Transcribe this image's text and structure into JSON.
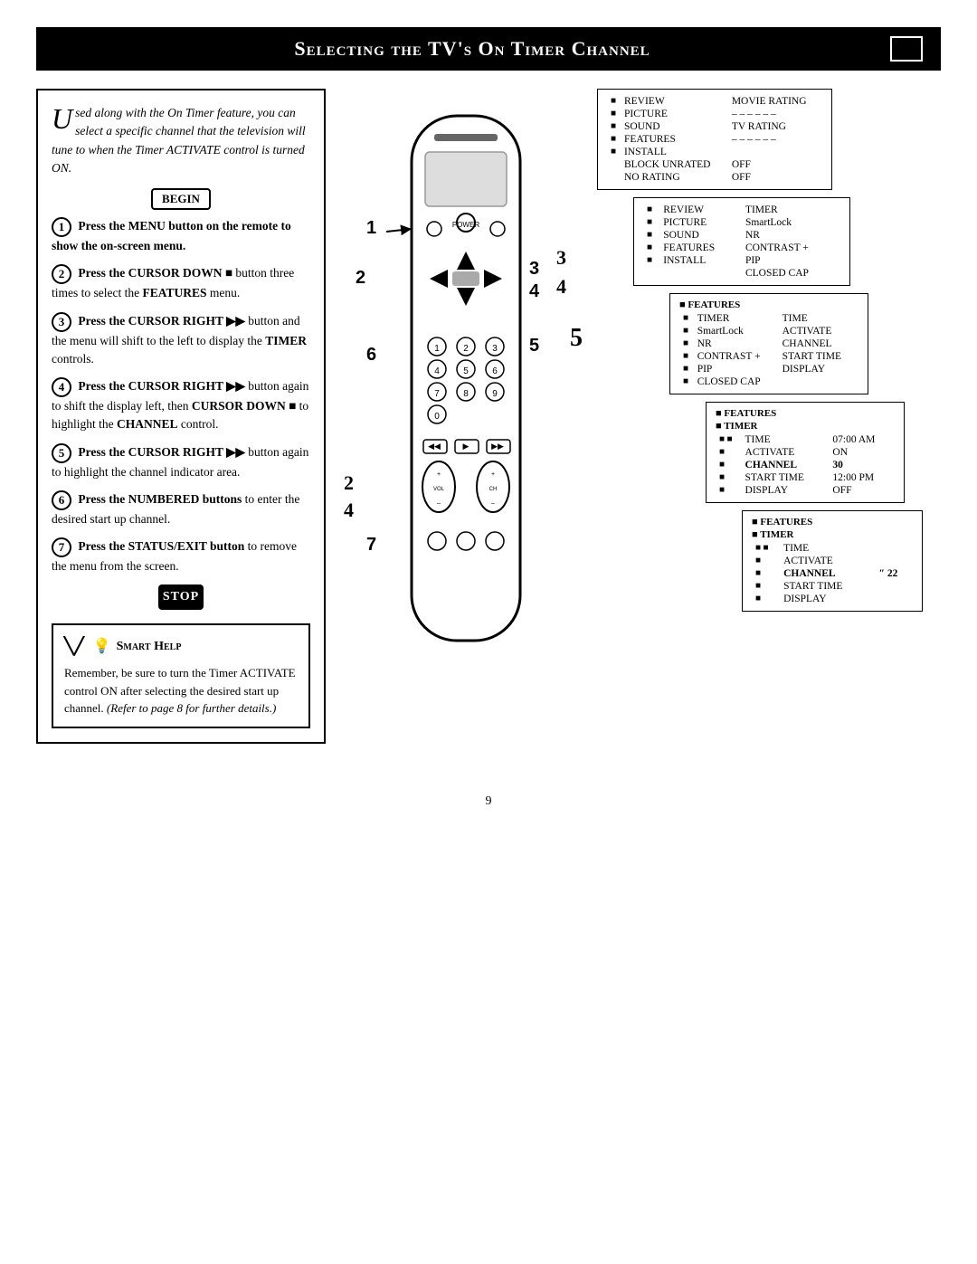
{
  "title": "Selecting the TV's On Timer Channel",
  "title_box": "",
  "intro": {
    "drop_cap": "U",
    "text": "sed along with the On Timer feature, you can select a specific channel that the television will tune to when the Timer ACTIVATE control is turned ON."
  },
  "begin_label": "BEGIN",
  "stop_label": "STOP",
  "steps": [
    {
      "num": "1",
      "text": "Press the MENU button on the remote to show the on-screen menu."
    },
    {
      "num": "2",
      "text": "Press the CURSOR DOWN ■ button three times to select the FEATURES menu."
    },
    {
      "num": "3",
      "text": "Press the CURSOR RIGHT ►► button and the menu will shift to the left to display the TIMER controls."
    },
    {
      "num": "4",
      "text": "Press the CURSOR RIGHT ►► button again to shift the display left, then CURSOR DOWN ■ to highlight the CHANNEL control."
    },
    {
      "num": "5",
      "text": "Press the CURSOR RIGHT ►► button again to highlight the channel indicator area."
    },
    {
      "num": "6",
      "text": "Press the NUMBERED buttons to enter the desired start up channel."
    },
    {
      "num": "7",
      "text": "Press the STATUS/EXIT button to remove the menu from the screen."
    }
  ],
  "smart_help": {
    "title": "Smart Help",
    "text": "Remember, be sure to turn the Timer ACTIVATE control ON after selecting the desired start up channel.",
    "italic_text": "(Refer to page 8 for further details.)"
  },
  "panels": {
    "panel1": {
      "title": "",
      "rows": [
        {
          "bullet": "■",
          "label": "REVIEW",
          "value": "MOVIE RATING"
        },
        {
          "bullet": "■",
          "label": "PICTURE",
          "value": "– – – – – –"
        },
        {
          "bullet": "■",
          "label": "SOUND",
          "value": "TV RATING"
        },
        {
          "bullet": "■",
          "label": "FEATURES",
          "value": "– – – – – –"
        },
        {
          "bullet": "■",
          "label": "INSTALL",
          "value": ""
        },
        {
          "bullet": "",
          "label": "BLOCK UNRATED",
          "value": "OFF"
        },
        {
          "bullet": "",
          "label": "NO RATING",
          "value": "OFF"
        }
      ]
    },
    "panel2": {
      "rows": [
        {
          "bullet": "■",
          "label": "REVIEW",
          "value": "TIMER"
        },
        {
          "bullet": "■",
          "label": "PICTURE",
          "value": "SmartLock"
        },
        {
          "bullet": "■",
          "label": "SOUND",
          "value": "NR"
        },
        {
          "bullet": "■",
          "label": "FEATURES",
          "value": "CONTRAST +"
        },
        {
          "bullet": "■",
          "label": "INSTALL",
          "value": "PIP"
        },
        {
          "bullet": "",
          "label": "",
          "value": "CLOSED CAP"
        }
      ]
    },
    "panel3": {
      "header": "■ FEATURES",
      "rows": [
        {
          "bullet": "■",
          "label": "TIMER",
          "value": "TIME"
        },
        {
          "bullet": "■",
          "label": "SmartLock",
          "value": "ACTIVATE"
        },
        {
          "bullet": "■",
          "label": "NR",
          "value": "CHANNEL"
        },
        {
          "bullet": "■",
          "label": "CONTRAST +",
          "value": "START TIME"
        },
        {
          "bullet": "■",
          "label": "PIP",
          "value": "DISPLAY"
        },
        {
          "bullet": "■",
          "label": "CLOSED CAP",
          "value": ""
        }
      ]
    },
    "panel4": {
      "header": "■ FEATURES",
      "subheader": "■ TIMER",
      "rows": [
        {
          "bullet": "■",
          "subbullet": "■",
          "label": "TIME",
          "value": "07:00 AM"
        },
        {
          "bullet": "■",
          "label": "ACTIVATE",
          "value": "ON"
        },
        {
          "bullet": "■",
          "label": "CHANNEL",
          "value": "30",
          "bold": true
        },
        {
          "bullet": "■",
          "label": "START TIME",
          "value": "12:00 PM"
        },
        {
          "bullet": "■",
          "label": "DISPLAY",
          "value": "OFF"
        }
      ]
    },
    "panel5": {
      "header": "■ FEATURES",
      "subheader": "■ TIMER",
      "rows": [
        {
          "bullet": "■",
          "subbullet": "■",
          "label": "TIME",
          "value": ""
        },
        {
          "bullet": "■",
          "label": "ACTIVATE",
          "value": ""
        },
        {
          "bullet": "■",
          "label": "CHANNEL",
          "value": "\" 22",
          "bold": true
        },
        {
          "bullet": "■",
          "label": "START TIME",
          "value": ""
        },
        {
          "bullet": "■",
          "label": "DISPLAY",
          "value": ""
        }
      ]
    }
  },
  "page_number": "9"
}
